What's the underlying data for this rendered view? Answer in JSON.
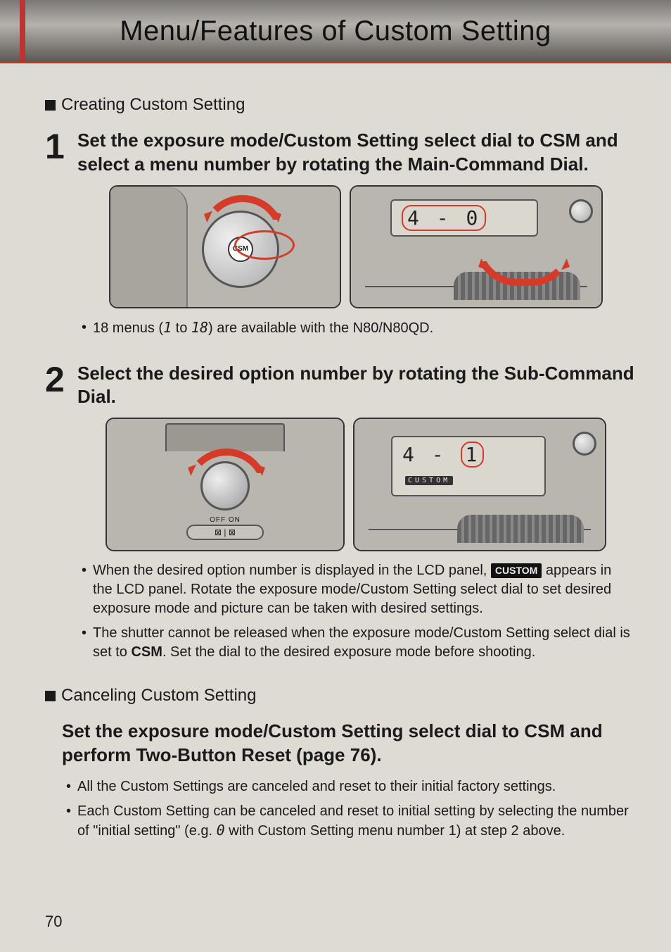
{
  "header": {
    "title": "Menu/Features of Custom Setting"
  },
  "section_create": {
    "heading": "Creating Custom Setting",
    "step1": {
      "num": "1",
      "title_pre": "Set the exposure mode/Custom Setting select dial to ",
      "title_csm": "CSM",
      "title_post": " and select a menu number by rotating the Main-Command Dial.",
      "dial_label": "CSM",
      "lcd_readout_menu": "4",
      "lcd_readout_opt": "0",
      "note_pre": "18 menus (",
      "note_seg_a": "1",
      "note_mid": " to ",
      "note_seg_b": "18",
      "note_post": ") are available with the N80/N80QD."
    },
    "step2": {
      "num": "2",
      "title": "Select the desired option number by rotating the Sub-Command Dial.",
      "off_on": "OFF  ON",
      "sw_marks": "⊠    |   ⊠",
      "lcd_readout_menu": "4",
      "lcd_readout_opt": "1",
      "custom_tag": "CUSTOM",
      "bullet1_pre": "When the desired option number is displayed in the LCD panel, ",
      "bullet1_badge": "CUSTOM",
      "bullet1_post": " appears in the LCD panel. Rotate the exposure mode/Custom Setting select dial to set desired exposure mode and picture can be taken with desired settings.",
      "bullet2_pre": "The shutter cannot be released when the exposure mode/Custom Setting select dial is set to ",
      "bullet2_csm": "CSM",
      "bullet2_post": ". Set the dial to the desired exposure mode before shooting."
    }
  },
  "section_cancel": {
    "heading": "Canceling Custom Setting",
    "body_pre": "Set the exposure mode/Custom Setting select dial to ",
    "body_csm": "CSM",
    "body_post": " and perform Two-Button Reset (page 76).",
    "bullet1": "All the Custom Settings are canceled and reset to their initial factory settings.",
    "bullet2_pre": "Each Custom Setting can be canceled and reset to initial setting by selecting the number of \"initial setting\" (e.g. ",
    "bullet2_seg": "0",
    "bullet2_post": " with Custom Setting menu number 1) at step 2 above."
  },
  "page_number": "70"
}
